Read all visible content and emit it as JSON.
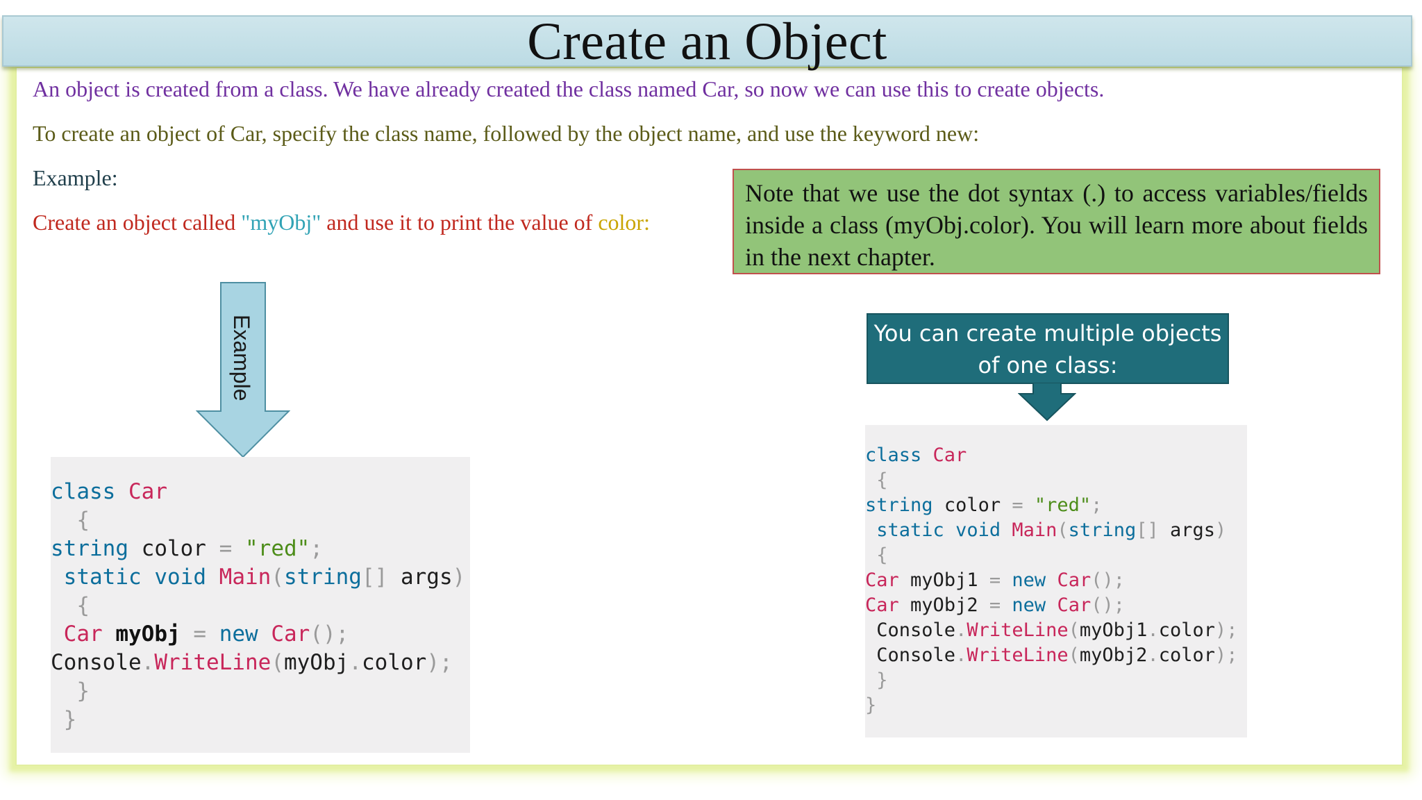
{
  "title": "Create an Object",
  "intro": "An object is created from a class. We have already created the class named Car, so now we can use this to create objects.",
  "howto": "To create an object of Car, specify the class name, followed by the object name, and use the keyword new:",
  "example_label": "Example:",
  "create_line": {
    "part1": "Create an object called ",
    "obj_name": "\"myObj\"",
    "part2": " and use it to print the value of ",
    "field_name": "color:"
  },
  "note": "Note that we use the dot syntax (.) to access variables/fields inside a class (myObj.color). You will learn more about fields in the next chapter.",
  "arrow_label": "Example",
  "multi_callout": {
    "line1": "You can create multiple objects",
    "line2": "of one class:"
  },
  "colors": {
    "title_bar": "#bcdbe4",
    "note_fill": "#92c479",
    "note_border": "#c0504d",
    "callout_fill": "#1f6d7a",
    "arrow_fill": "#a8d4e2",
    "frame_glow": "#e6f2a6"
  },
  "code_left": {
    "l1": [
      "class",
      "Car"
    ],
    "l2": "{",
    "l3": [
      "string",
      "color",
      "=",
      "\"red\"",
      ";"
    ],
    "l4": [
      "static",
      "void",
      "Main",
      "(",
      "string",
      "[]",
      "args",
      ")"
    ],
    "l5": "{",
    "l6": [
      "Car",
      "myObj",
      "=",
      "new",
      "Car",
      "();"
    ],
    "l7": [
      "Console",
      ".",
      "WriteLine",
      "(",
      "myObj",
      ".",
      "color",
      ");"
    ],
    "l8": "}",
    "l9": "}"
  },
  "code_right": {
    "l1": [
      "class",
      "Car"
    ],
    "l2": "{",
    "l3": [
      "string",
      "color",
      "=",
      "\"red\"",
      ";"
    ],
    "l4": [
      "static",
      "void",
      "Main",
      "(",
      "string",
      "[]",
      "args",
      ")"
    ],
    "l5": "{",
    "l6": [
      "Car",
      "myObj1",
      "=",
      "new",
      "Car",
      "();"
    ],
    "l7": [
      "Car",
      "myObj2",
      "=",
      "new",
      "Car",
      "();"
    ],
    "l8": [
      "Console",
      ".",
      "WriteLine",
      "(",
      "myObj1",
      ".",
      "color",
      ");"
    ],
    "l9": [
      "Console",
      ".",
      "WriteLine",
      "(",
      "myObj2",
      ".",
      "color",
      ");"
    ],
    "l10": "}",
    "l11": "}"
  }
}
